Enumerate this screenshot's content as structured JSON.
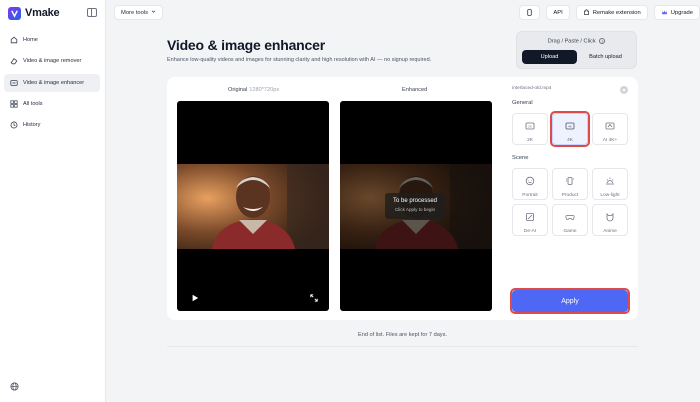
{
  "app": {
    "name": "Vmake"
  },
  "nav": [
    {
      "label": "Home",
      "icon": "home-icon"
    },
    {
      "label": "Video & image remover",
      "icon": "eraser-icon"
    },
    {
      "label": "Video & image enhancer",
      "icon": "enhance-icon",
      "active": true
    },
    {
      "label": "All tools",
      "icon": "grid-icon"
    },
    {
      "label": "History",
      "icon": "clock-icon"
    }
  ],
  "topbar": {
    "more_tools": "More tools",
    "api": "API",
    "remake": "Remake extension",
    "upgrade": "Upgrade"
  },
  "header": {
    "title": "Video & image enhancer",
    "subtitle": "Enhance low-quality videos and images for stunning clarity and high resolution with AI — no signup required."
  },
  "upload": {
    "hint": "Drag / Paste / Click",
    "upload_label": "Upload",
    "batch_label": "Batch upload"
  },
  "preview": {
    "original_label": "Original",
    "original_res": "1280*720px",
    "enhanced_label": "Enhanced",
    "processing_title": "To be processed",
    "processing_sub": "Click Apply to begin"
  },
  "panel": {
    "filename": "interlaced-old.mp4",
    "general_label": "General",
    "general": [
      {
        "label": "2K",
        "icon": "2k-icon"
      },
      {
        "label": "4K",
        "icon": "4k-icon",
        "selected": true
      },
      {
        "label": "AI 4K+",
        "icon": "ai4k-icon"
      }
    ],
    "scene_label": "Scene",
    "scene": [
      {
        "label": "Portrait",
        "icon": "face-icon"
      },
      {
        "label": "Product",
        "icon": "product-icon"
      },
      {
        "label": "Low-light",
        "icon": "sunrise-icon"
      },
      {
        "label": "De-AI",
        "icon": "deai-icon"
      },
      {
        "label": "Game",
        "icon": "gamepad-icon"
      },
      {
        "label": "Anime",
        "icon": "anime-icon"
      }
    ],
    "apply_label": "Apply"
  },
  "footer": {
    "note": "End of list. Files are kept for 7 days."
  },
  "colors": {
    "accent": "#4f67f5",
    "highlight": "#dc4a4a",
    "dark": "#111827"
  }
}
